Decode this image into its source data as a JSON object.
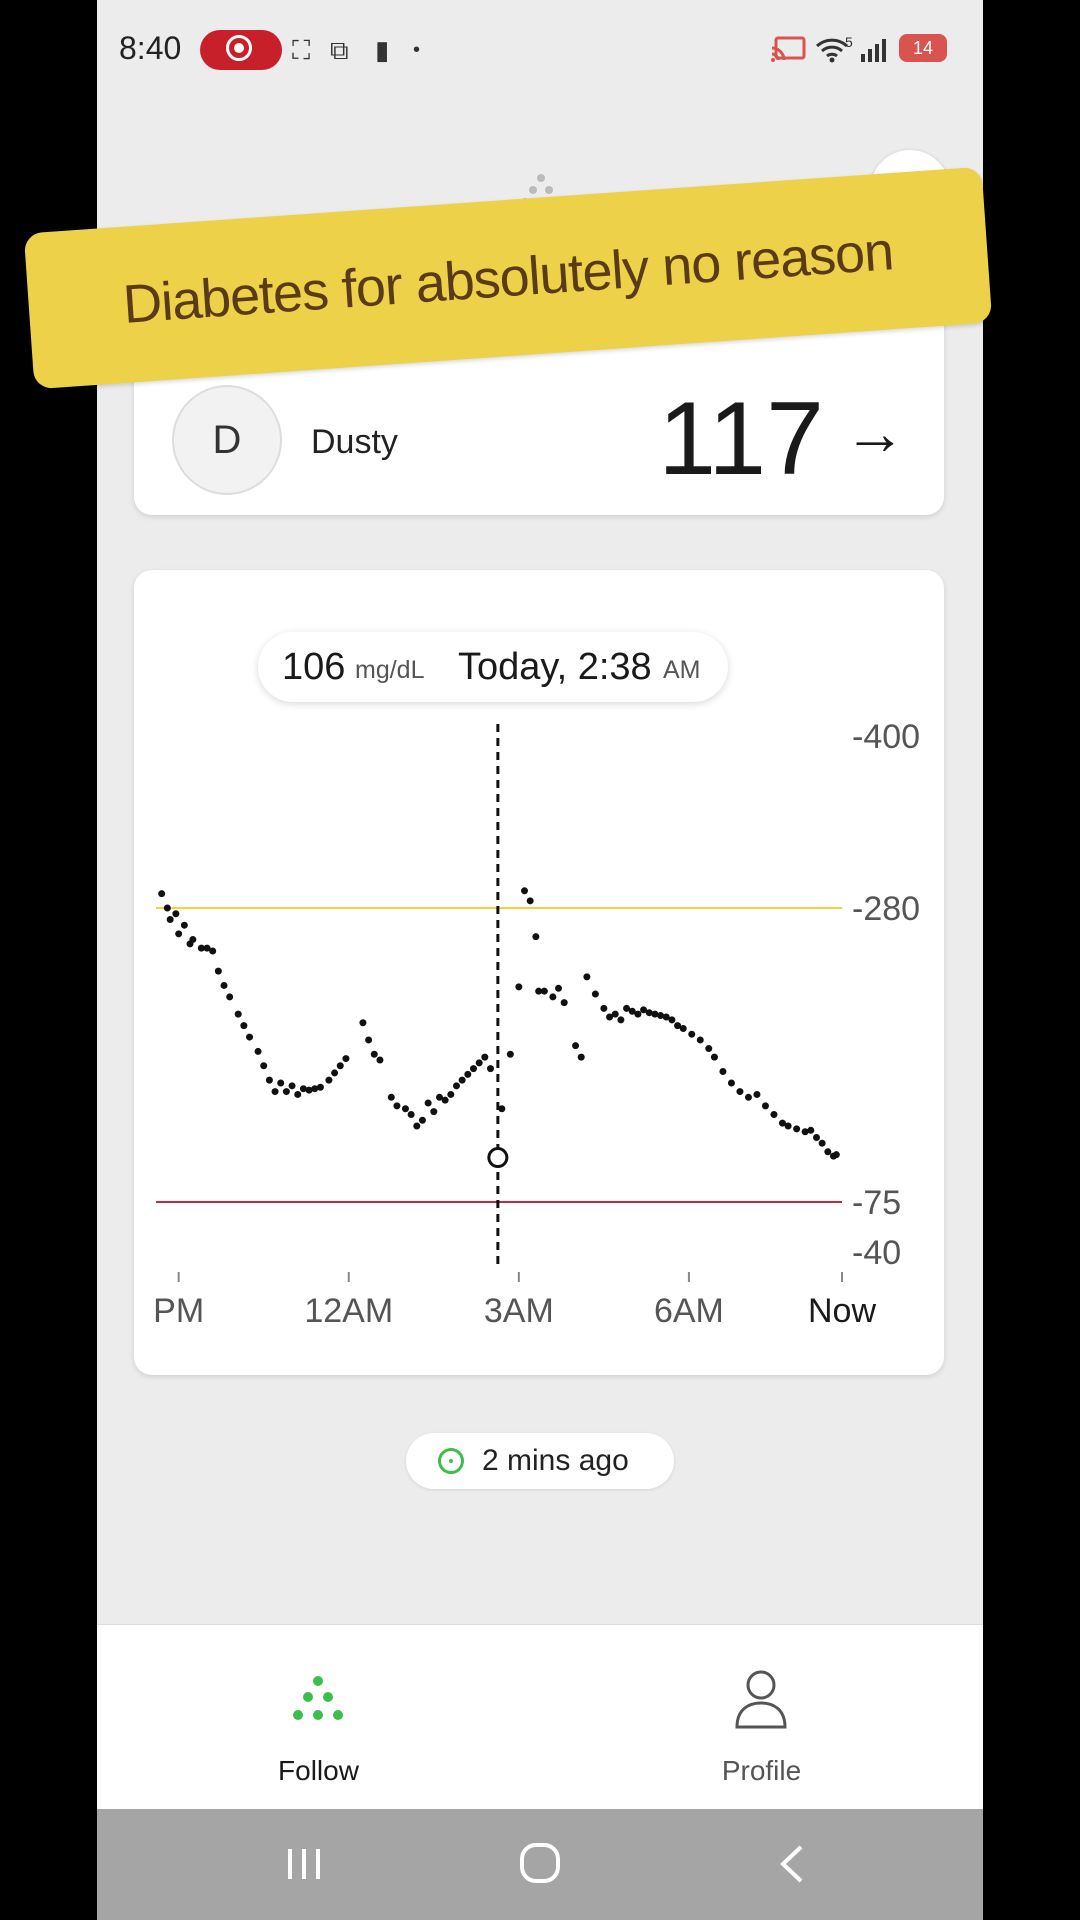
{
  "status_bar": {
    "time": "8:40",
    "battery": "14",
    "network": "5"
  },
  "banner": {
    "text": "Diabetes for absolutely no reason"
  },
  "patient": {
    "initial": "D",
    "name": "Dusty",
    "glucose": "117",
    "trend": "→"
  },
  "tooltip": {
    "value": "106",
    "unit": "mg/dL",
    "time": "Today, 2:38",
    "ampm": "AM"
  },
  "chart_data": {
    "type": "scatter",
    "y_ticks": [
      400,
      280,
      75,
      40
    ],
    "x_ticks": [
      "PM",
      "12AM",
      "3AM",
      "6AM",
      "Now"
    ],
    "x_tick_hours": [
      -3,
      0,
      3,
      6,
      8.7
    ],
    "x_range_hours": [
      -3.4,
      8.7
    ],
    "ylim": [
      40,
      400
    ],
    "high_threshold": 280,
    "low_threshold": 75,
    "colors": {
      "high": "#f1d33c",
      "low": "#c62a3a",
      "points": "#111111"
    },
    "selected_point": {
      "x_hours": 2.63,
      "y": 106
    },
    "points": [
      [
        -3.3,
        290
      ],
      [
        -3.2,
        280
      ],
      [
        -3.15,
        272
      ],
      [
        -3.05,
        276
      ],
      [
        -3.0,
        262
      ],
      [
        -2.9,
        268
      ],
      [
        -2.8,
        255
      ],
      [
        -2.75,
        258
      ],
      [
        -2.6,
        252
      ],
      [
        -2.5,
        252
      ],
      [
        -2.4,
        250
      ],
      [
        -2.3,
        236
      ],
      [
        -2.2,
        226
      ],
      [
        -2.1,
        218
      ],
      [
        -1.95,
        206
      ],
      [
        -1.85,
        198
      ],
      [
        -1.75,
        190
      ],
      [
        -1.6,
        180
      ],
      [
        -1.5,
        170
      ],
      [
        -1.4,
        160
      ],
      [
        -1.3,
        152
      ],
      [
        -1.2,
        158
      ],
      [
        -1.1,
        152
      ],
      [
        -1.0,
        156
      ],
      [
        -0.9,
        150
      ],
      [
        -0.8,
        154
      ],
      [
        -0.7,
        153
      ],
      [
        -0.6,
        154
      ],
      [
        -0.5,
        155
      ],
      [
        -0.35,
        160
      ],
      [
        -0.25,
        165
      ],
      [
        -0.15,
        170
      ],
      [
        -0.05,
        175
      ],
      [
        0.25,
        200
      ],
      [
        0.35,
        188
      ],
      [
        0.45,
        178
      ],
      [
        0.55,
        174
      ],
      [
        0.75,
        148
      ],
      [
        0.85,
        142
      ],
      [
        1.0,
        140
      ],
      [
        1.1,
        136
      ],
      [
        1.2,
        128
      ],
      [
        1.3,
        132
      ],
      [
        1.4,
        144
      ],
      [
        1.5,
        138
      ],
      [
        1.6,
        148
      ],
      [
        1.7,
        146
      ],
      [
        1.8,
        150
      ],
      [
        1.9,
        156
      ],
      [
        2.0,
        160
      ],
      [
        2.1,
        164
      ],
      [
        2.2,
        168
      ],
      [
        2.3,
        172
      ],
      [
        2.4,
        176
      ],
      [
        2.5,
        168
      ],
      [
        2.63,
        106
      ],
      [
        2.7,
        140
      ],
      [
        2.85,
        178
      ],
      [
        3.0,
        225
      ],
      [
        3.1,
        292
      ],
      [
        3.2,
        285
      ],
      [
        3.3,
        260
      ],
      [
        3.35,
        222
      ],
      [
        3.45,
        222
      ],
      [
        3.6,
        218
      ],
      [
        3.7,
        224
      ],
      [
        3.8,
        214
      ],
      [
        4.0,
        184
      ],
      [
        4.1,
        176
      ],
      [
        4.2,
        232
      ],
      [
        4.35,
        220
      ],
      [
        4.5,
        210
      ],
      [
        4.6,
        204
      ],
      [
        4.7,
        206
      ],
      [
        4.8,
        202
      ],
      [
        4.9,
        210
      ],
      [
        5.0,
        208
      ],
      [
        5.1,
        206
      ],
      [
        5.2,
        209
      ],
      [
        5.3,
        207
      ],
      [
        5.4,
        206
      ],
      [
        5.5,
        205
      ],
      [
        5.6,
        204
      ],
      [
        5.7,
        202
      ],
      [
        5.8,
        198
      ],
      [
        5.9,
        196
      ],
      [
        6.05,
        192
      ],
      [
        6.2,
        188
      ],
      [
        6.35,
        182
      ],
      [
        6.45,
        176
      ],
      [
        6.6,
        166
      ],
      [
        6.75,
        158
      ],
      [
        6.9,
        152
      ],
      [
        7.05,
        148
      ],
      [
        7.2,
        150
      ],
      [
        7.35,
        142
      ],
      [
        7.5,
        136
      ],
      [
        7.65,
        130
      ],
      [
        7.75,
        128
      ],
      [
        7.9,
        126
      ],
      [
        8.05,
        124
      ],
      [
        8.15,
        125
      ],
      [
        8.25,
        120
      ],
      [
        8.35,
        116
      ],
      [
        8.45,
        110
      ],
      [
        8.55,
        107
      ],
      [
        8.6,
        108
      ]
    ]
  },
  "last_updated": "2 mins ago",
  "nav": {
    "follow_label": "Follow",
    "profile_label": "Profile"
  }
}
